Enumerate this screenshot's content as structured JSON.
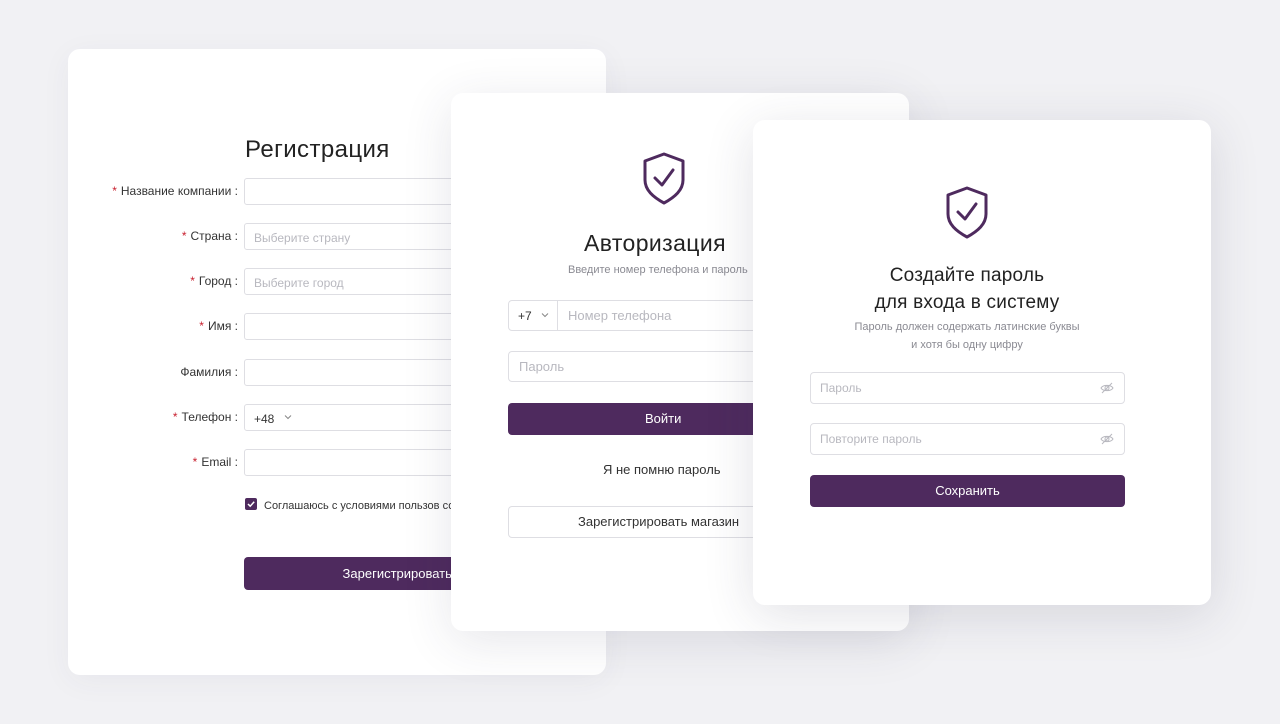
{
  "colors": {
    "accent": "#4e2a5e",
    "required": "#c8202f",
    "border": "#dedee3",
    "placeholder": "#b8b8bf",
    "background": "#f1f1f4"
  },
  "registration": {
    "title": "Регистрация",
    "fields": [
      {
        "label": "Название компании :",
        "required": true,
        "placeholder": ""
      },
      {
        "label": "Страна :",
        "required": true,
        "placeholder": "Выберите страну"
      },
      {
        "label": "Город :",
        "required": true,
        "placeholder": "Выберите город"
      },
      {
        "label": "Имя :",
        "required": true,
        "placeholder": ""
      },
      {
        "label": "Фамилия :",
        "required": false,
        "placeholder": ""
      },
      {
        "label": "Телефон :",
        "required": true,
        "code": "+48"
      },
      {
        "label": "Email :",
        "required": true,
        "placeholder": ""
      }
    ],
    "agreement_checked": true,
    "agreement_text": "Соглашаюсь с условиями пользов соглашения",
    "submit_label": "Зарегистрироваться"
  },
  "auth": {
    "icon": "shield-check-icon",
    "title": "Авторизация",
    "subtitle": "Введите номер телефона и пароль",
    "phone_code": "+7",
    "phone_placeholder": "Номер телефона",
    "password_placeholder": "Пароль",
    "login_label": "Войти",
    "forgot_label": "Я не помню пароль",
    "register_label": "Зарегистрировать магазин"
  },
  "create_password": {
    "icon": "shield-check-icon",
    "title_line1": "Создайте пароль",
    "title_line2": "для входа в систему",
    "hint_line1": "Пароль должен содержать латинские буквы",
    "hint_line2": "и хотя бы одну цифру",
    "password_placeholder": "Пароль",
    "repeat_placeholder": "Повторите пароль",
    "save_label": "Сохранить"
  }
}
